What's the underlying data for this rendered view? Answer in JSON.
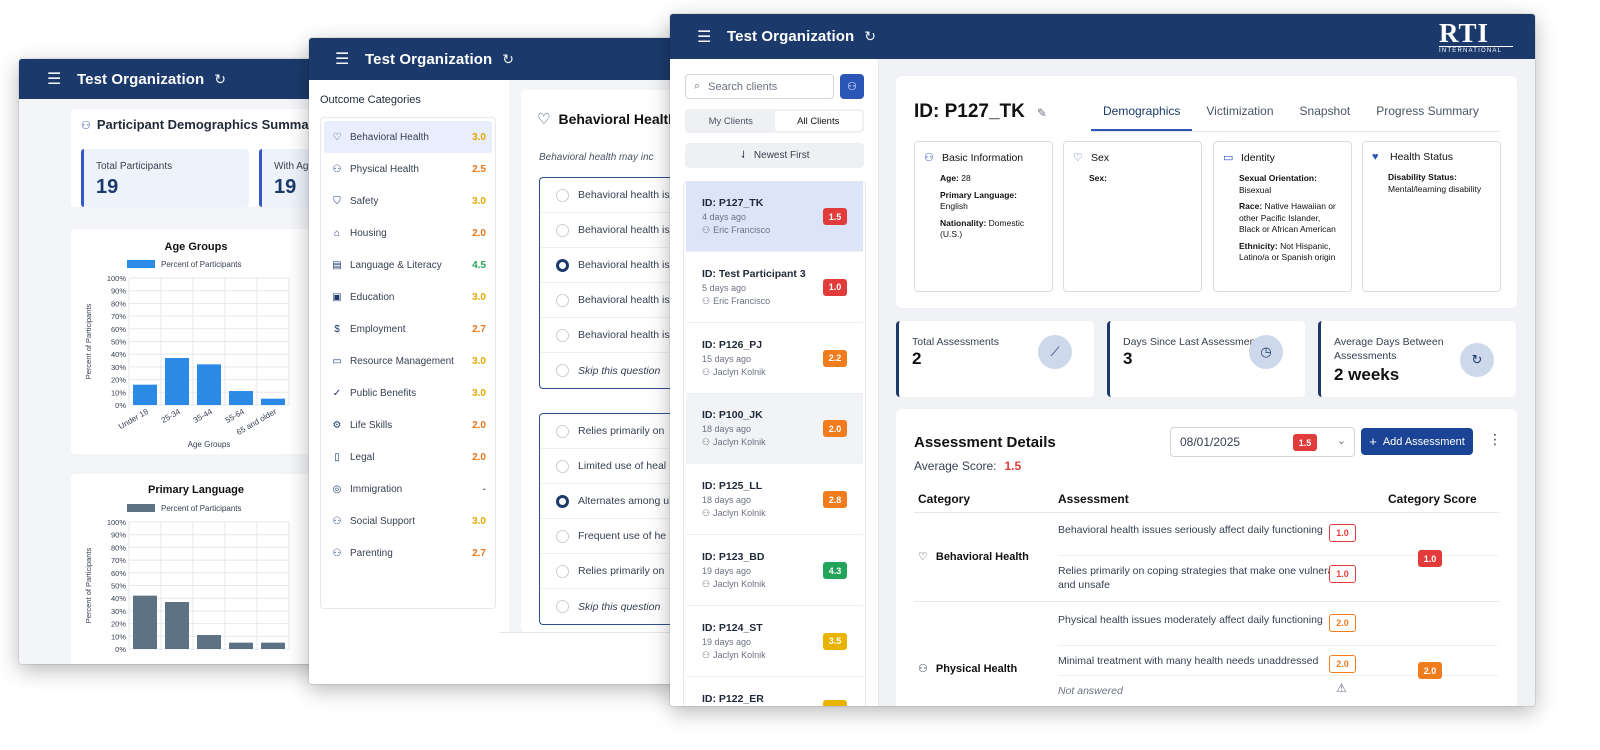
{
  "org_name": "Test Organization",
  "window1": {
    "summary_title": "Participant Demographics Summary",
    "stats": [
      {
        "label": "Total Participants",
        "value": "19"
      },
      {
        "label": "With Ag",
        "value": "19"
      }
    ],
    "charts": [
      {
        "title": "Age Groups",
        "legend": "Percent of Participants",
        "ylabel": "Percent of Participants",
        "xlabel": "Age Groups",
        "color": "#2b8ae6",
        "yticks": [
          "0%",
          "10%",
          "20%",
          "30%",
          "40%",
          "50%",
          "60%",
          "70%",
          "80%",
          "90%",
          "100%"
        ],
        "categories": [
          "Under 18",
          "25-34",
          "35-44",
          "55-64",
          "65 and older"
        ],
        "values": [
          16,
          37,
          32,
          11,
          5
        ]
      },
      {
        "title": "Primary Language",
        "legend": "Percent of Participants",
        "ylabel": "Percent of Participants",
        "color": "#5d7384",
        "yticks": [
          "0%",
          "10%",
          "20%",
          "30%",
          "40%",
          "50%",
          "60%",
          "70%",
          "80%",
          "90%",
          "100%"
        ],
        "values": [
          42,
          37,
          11,
          5,
          5
        ]
      }
    ]
  },
  "window2": {
    "categories_title": "Outcome Categories",
    "categories": [
      {
        "label": "Behavioral Health",
        "score": "3.0",
        "icon": "heart-icon",
        "glyph": "♡",
        "color": "#e5a400"
      },
      {
        "label": "Physical Health",
        "score": "2.5",
        "icon": "person-icon",
        "glyph": "⚇",
        "color": "#e8751a"
      },
      {
        "label": "Safety",
        "score": "3.0",
        "icon": "shield-icon",
        "glyph": "⛉",
        "color": "#e5a400"
      },
      {
        "label": "Housing",
        "score": "2.0",
        "icon": "home-icon",
        "glyph": "⌂",
        "color": "#e8751a"
      },
      {
        "label": "Language & Literacy",
        "score": "4.5",
        "icon": "book-icon",
        "glyph": "▤",
        "color": "#22a55a"
      },
      {
        "label": "Education",
        "score": "3.0",
        "icon": "briefcase-icon",
        "glyph": "▣",
        "color": "#e5a400"
      },
      {
        "label": "Employment",
        "score": "2.7",
        "icon": "dollar-icon",
        "glyph": "$",
        "color": "#e8751a"
      },
      {
        "label": "Resource Management",
        "score": "3.0",
        "icon": "wallet-icon",
        "glyph": "▭",
        "color": "#e5a400"
      },
      {
        "label": "Public Benefits",
        "score": "3.0",
        "icon": "check-circle-icon",
        "glyph": "✓",
        "color": "#e5a400"
      },
      {
        "label": "Life Skills",
        "score": "2.0",
        "icon": "gear-icon",
        "glyph": "⚙",
        "color": "#e8751a"
      },
      {
        "label": "Legal",
        "score": "2.0",
        "icon": "document-icon",
        "glyph": "▯",
        "color": "#e8751a"
      },
      {
        "label": "Immigration",
        "score": "-",
        "icon": "globe-icon",
        "glyph": "◎",
        "color": "#6b7280"
      },
      {
        "label": "Social Support",
        "score": "3.0",
        "icon": "users-icon",
        "glyph": "⚇",
        "color": "#e5a400"
      },
      {
        "label": "Parenting",
        "score": "2.7",
        "icon": "family-icon",
        "glyph": "⚇",
        "color": "#e8751a"
      }
    ],
    "section_title": "Behavioral Health",
    "section_desc": "Behavioral health may inc",
    "question1": [
      "Behavioral health is",
      "Behavioral health is",
      "Behavioral health is",
      "Behavioral health is",
      "Behavioral health is"
    ],
    "question1_selected": 2,
    "question2": [
      "Relies primarily on",
      "Limited use of heal",
      "Alternates among u",
      "Frequent use of he",
      "Relies primarily on"
    ],
    "question2_selected": 2,
    "skip_label": "Skip this question"
  },
  "window3": {
    "logo_text": "RTI",
    "logo_sub": "INTERNATIONAL",
    "search_placeholder": "Search clients",
    "toggle": [
      "My Clients",
      "All Clients"
    ],
    "sort_label": "Newest First",
    "clients": [
      {
        "id": "ID: P127_TK",
        "ago": "4 days ago",
        "user": "Eric Francisco",
        "score": "1.5",
        "color": "#e23b3b"
      },
      {
        "id": "ID: Test Participant 3",
        "ago": "5 days ago",
        "user": "Eric Francisco",
        "score": "1.0",
        "color": "#e23b3b"
      },
      {
        "id": "ID: P126_PJ",
        "ago": "15 days ago",
        "user": "Jaclyn Kolnik",
        "score": "2.2",
        "color": "#f07c1e"
      },
      {
        "id": "ID: P100_JK",
        "ago": "18 days ago",
        "user": "Jaclyn Kolnik",
        "score": "2.0",
        "color": "#f07c1e"
      },
      {
        "id": "ID: P125_LL",
        "ago": "18 days ago",
        "user": "Jaclyn Kolnik",
        "score": "2.8",
        "color": "#f07c1e"
      },
      {
        "id": "ID: P123_BD",
        "ago": "19 days ago",
        "user": "Jaclyn Kolnik",
        "score": "4.3",
        "color": "#22a55a"
      },
      {
        "id": "ID: P124_ST",
        "ago": "19 days ago",
        "user": "Jaclyn Kolnik",
        "score": "3.5",
        "color": "#e8b400"
      },
      {
        "id": "ID: P122_ER",
        "ago": "",
        "user": "",
        "score": "",
        "color": "#e8b400"
      }
    ],
    "participant_id": "ID: P127_TK",
    "tabs": [
      "Demographics",
      "Victimization",
      "Snapshot",
      "Progress Summary"
    ],
    "basic": {
      "title": "Basic Information",
      "age_label": "Age:",
      "age": "28",
      "lang_label": "Primary Language:",
      "lang": "English",
      "nat_label": "Nationality:",
      "nat": "Domestic (U.S.)"
    },
    "sex": {
      "title": "Sex",
      "label": "Sex:"
    },
    "identity": {
      "title": "Identity",
      "so_label": "Sexual Orientation:",
      "so": "Bisexual",
      "race_label": "Race:",
      "race": "Native Hawaiian or other Pacific Islander, Black or African American",
      "eth_label": "Ethnicity:",
      "eth": "Not Hispanic, Latino/a or Spanish origin"
    },
    "health": {
      "title": "Health Status",
      "dis_label": "Disability Status:",
      "dis": "Mental/learning disability"
    },
    "metrics": [
      {
        "label": "Total Assessments",
        "value": "2",
        "icon": "chart-icon",
        "glyph": "⟋"
      },
      {
        "label": "Days Since Last Assessment",
        "value": "3",
        "icon": "clock-icon",
        "glyph": "◷"
      },
      {
        "label": "Average Days Between Assessments",
        "value": "2 weeks",
        "icon": "refresh-icon",
        "glyph": "↻"
      }
    ],
    "assess": {
      "title": "Assessment Details",
      "avg_label": "Average Score:",
      "avg": "1.5",
      "date": "08/01/2025",
      "date_score": "1.5",
      "add_label": "Add Assessment",
      "col_category": "Category",
      "col_assessment": "Assessment",
      "col_score": "Category Score",
      "cat1": "Behavioral Health",
      "cat1_score": "1.0",
      "cat1_rows": [
        {
          "text": "Behavioral health issues seriously affect daily functioning",
          "score": "1.0"
        },
        {
          "text": "Relies primarily on coping strategies that make one vulnerable and unsafe",
          "score": "1.0"
        }
      ],
      "cat2": "Physical Health",
      "cat2_score": "2.0",
      "cat2_rows": [
        {
          "text": "Physical health issues moderately affect daily functioning",
          "score": "2.0"
        },
        {
          "text": "Minimal treatment with many health needs unaddressed",
          "score": "2.0"
        }
      ],
      "not_answered": "Not answered"
    }
  }
}
